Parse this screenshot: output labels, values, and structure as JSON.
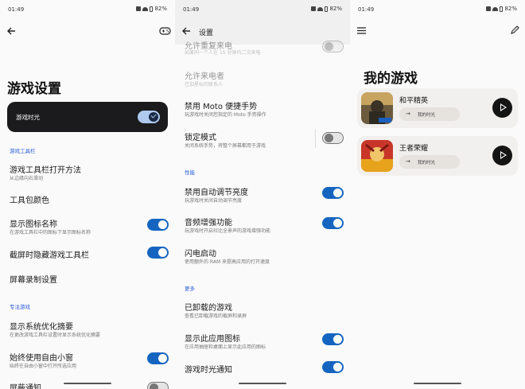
{
  "status": {
    "time_1": "01:49",
    "time_2": "01:49",
    "time_3": "01:49",
    "battery": "82%"
  },
  "panel1": {
    "page_title": "游戏设置",
    "game_time_label": "游戏时光",
    "sec_toolbar": "游戏工具栏",
    "rows": [
      {
        "title": "游戏工具栏打开方法",
        "sub": "从边缘向右滑动"
      },
      {
        "title": "工具包颜色",
        "sub": ""
      },
      {
        "title": "显示图标名称",
        "sub": "在游戏工具栏中的图标下显示图标名称"
      },
      {
        "title": "截屏时隐藏游戏工具栏",
        "sub": ""
      },
      {
        "title": "屏幕录制设置",
        "sub": ""
      }
    ],
    "sec_focus": "专注游戏",
    "rows2": [
      {
        "title": "显示系统优化摘要",
        "sub": "在更改游戏工具栏设置时显示系统优化摘要"
      },
      {
        "title": "始终使用自由小窗",
        "sub": "始终在自由小窗中打开所选应用"
      },
      {
        "title": "屏蔽通知",
        "sub": ""
      }
    ]
  },
  "panel2": {
    "header_title": "设置",
    "rows_top": [
      {
        "title": "允许重复来电",
        "sub": "如果同一个人在 15 分钟内二次来电"
      },
      {
        "title": "允许来电者",
        "sub": "已加星标的联系人"
      },
      {
        "title": "禁用 Moto 便捷手势",
        "sub": "玩游戏时关闭您指定的 Moto 手势操作"
      },
      {
        "title": "锁定模式",
        "sub": "关闭系统手势，将整个屏幕都用于游戏"
      }
    ],
    "sec_perf": "性能",
    "rows_perf": [
      {
        "title": "禁用自动调节亮度",
        "sub": "玩游戏时关闭自动调节亮度"
      },
      {
        "title": "音频增强功能",
        "sub": "玩游戏时开启社比全景声的游戏增强功能"
      },
      {
        "title": "闪电启动",
        "sub": "使用额外的 RAM 来提高应用的打开速度"
      }
    ],
    "sec_more": "更多",
    "rows_more": [
      {
        "title": "已卸载的游戏",
        "sub": "查看已卸载游戏的截屏和录屏"
      },
      {
        "title": "显示此应用图标",
        "sub": "在应用抽屉和桌面上显示此应用的图标"
      },
      {
        "title": "游戏时光通知",
        "sub": ""
      }
    ]
  },
  "panel3": {
    "page_title": "我的游戏",
    "games": [
      {
        "name": "和平精英",
        "pill": "我的时光"
      },
      {
        "name": "王者荣耀",
        "pill": "我的时光"
      }
    ]
  }
}
